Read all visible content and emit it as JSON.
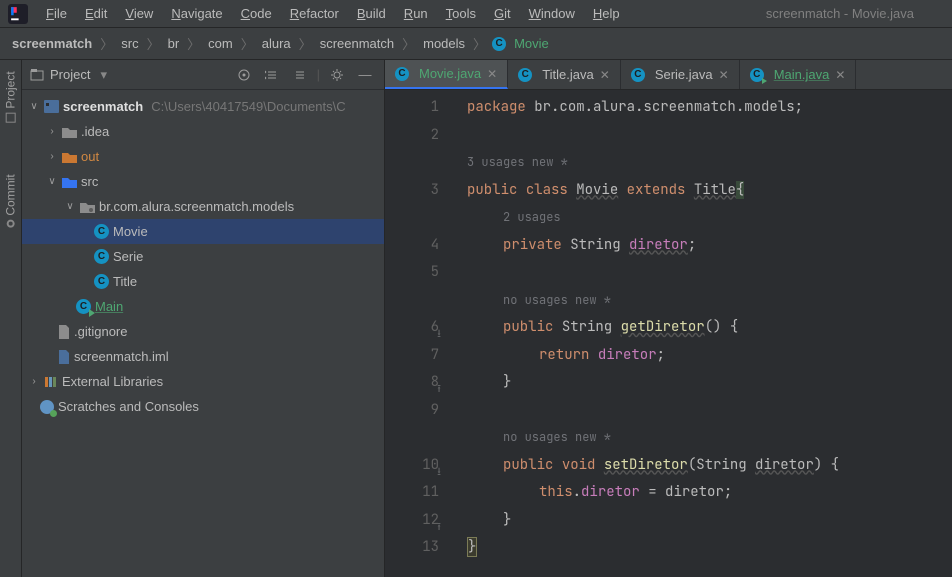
{
  "window_title": "screenmatch - Movie.java",
  "menubar": [
    "File",
    "Edit",
    "View",
    "Navigate",
    "Code",
    "Refactor",
    "Build",
    "Run",
    "Tools",
    "Git",
    "Window",
    "Help"
  ],
  "breadcrumbs": {
    "parts": [
      "screenmatch",
      "src",
      "br",
      "com",
      "alura",
      "screenmatch",
      "models"
    ],
    "final": "Movie"
  },
  "project_header": {
    "title": "Project"
  },
  "tree": {
    "project_name": "screenmatch",
    "project_path": "C:\\Users\\40417549\\Documents\\C",
    "idea_folder": ".idea",
    "out_folder": "out",
    "src_folder": "src",
    "package": "br.com.alura.screenmatch.models",
    "class_movie": "Movie",
    "class_serie": "Serie",
    "class_title": "Title",
    "class_main": "Main",
    "gitignore": ".gitignore",
    "iml": "screenmatch.iml",
    "ext_lib": "External Libraries",
    "scratches": "Scratches and Consoles"
  },
  "tabs": [
    {
      "label": "Movie.java",
      "active": true,
      "style": "greenish"
    },
    {
      "label": "Title.java",
      "active": false,
      "style": ""
    },
    {
      "label": "Serie.java",
      "active": false,
      "style": ""
    },
    {
      "label": "Main.java",
      "active": false,
      "style": "green"
    }
  ],
  "code": {
    "package_kw": "package",
    "package_val": "br.com.alura.screenmatch.models",
    "usages_class": "3 usages   new *",
    "public": "public",
    "class_kw": "class",
    "movie": "Movie",
    "extends": "extends",
    "title": "Title",
    "usages_field": "2 usages",
    "private": "private",
    "string": "String",
    "diretor": "diretor",
    "no_usages": "no usages   new *",
    "return": "return",
    "void": "void",
    "this": "this",
    "get_diretor": "getDiretor",
    "set_diretor": "setDiretor"
  },
  "line_numbers": [
    "1",
    "2",
    "",
    "3",
    "",
    "4",
    "5",
    "",
    "6",
    "7",
    "8",
    "9",
    "",
    "10",
    "11",
    "12",
    "13"
  ],
  "vtabs": {
    "project": "Project",
    "commit": "Commit"
  }
}
